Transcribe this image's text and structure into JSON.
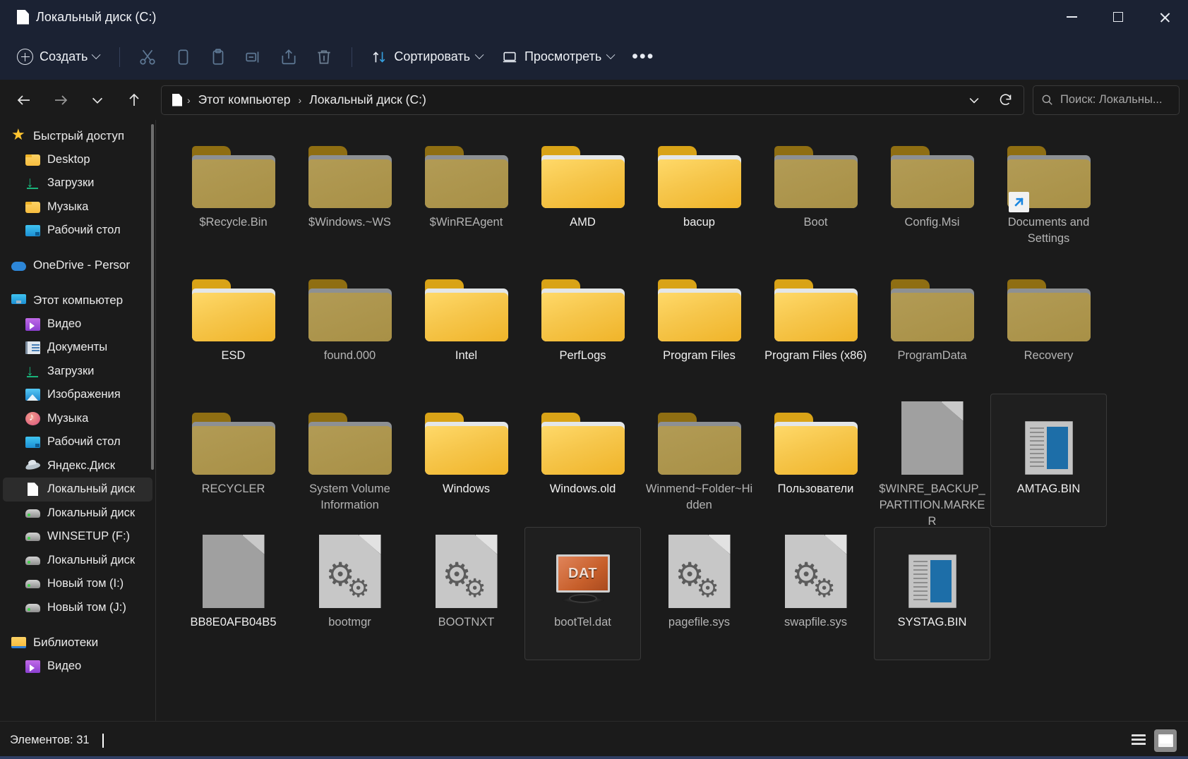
{
  "window": {
    "title": "Локальный диск (C:)",
    "title_icon": "document-icon",
    "minimize_label": "Свернуть",
    "maximize_label": "Развернуть",
    "close_label": "Закрыть"
  },
  "toolbar": {
    "new_label": "Создать",
    "cut_label": "Вырезать",
    "copy_label": "Копировать",
    "paste_label": "Вставить",
    "rename_label": "Переименовать",
    "share_label": "Поделиться",
    "delete_label": "Удалить",
    "sort_label": "Сортировать",
    "view_label": "Просмотреть",
    "more_label": "Подробнее"
  },
  "nav": {
    "back_label": "Назад",
    "forward_label": "Вперёд",
    "recent_label": "Последние расположения",
    "up_label": "Вверх",
    "refresh_label": "Обновить",
    "dropdown_label": "Предыдущие расположения"
  },
  "breadcrumb": {
    "icon": "document-icon",
    "items": [
      "Этот компьютер",
      "Локальный диск (C:)"
    ],
    "separator": "›"
  },
  "search": {
    "placeholder": "Поиск: Локальны...",
    "value": "",
    "icon": "search-icon"
  },
  "sidebar": {
    "groups": [
      {
        "items": [
          {
            "label": "Быстрый доступ",
            "icon": "star-icon",
            "level": 0,
            "selected": false
          },
          {
            "label": "Desktop",
            "icon": "folder-icon",
            "level": 1,
            "selected": false
          },
          {
            "label": "Загрузки",
            "icon": "download-icon",
            "level": 1,
            "selected": false
          },
          {
            "label": "Музыка",
            "icon": "folder-icon",
            "level": 1,
            "selected": false
          },
          {
            "label": "Рабочий стол",
            "icon": "desktop-icon",
            "level": 1,
            "selected": false
          }
        ]
      },
      {
        "items": [
          {
            "label": "OneDrive - Persor",
            "icon": "onedrive-icon",
            "level": 0,
            "selected": false
          }
        ]
      },
      {
        "items": [
          {
            "label": "Этот компьютер",
            "icon": "this-pc-icon",
            "level": 0,
            "selected": false
          },
          {
            "label": "Видео",
            "icon": "video-icon",
            "level": 1,
            "selected": false
          },
          {
            "label": "Документы",
            "icon": "documents-icon",
            "level": 1,
            "selected": false
          },
          {
            "label": "Загрузки",
            "icon": "download-icon",
            "level": 1,
            "selected": false
          },
          {
            "label": "Изображения",
            "icon": "pictures-icon",
            "level": 1,
            "selected": false
          },
          {
            "label": "Музыка",
            "icon": "music-icon",
            "level": 1,
            "selected": false
          },
          {
            "label": "Рабочий стол",
            "icon": "desktop-icon",
            "level": 1,
            "selected": false
          },
          {
            "label": "Яндекс.Диск",
            "icon": "yandex-disk-icon",
            "level": 1,
            "selected": false
          },
          {
            "label": "Локальный диск",
            "icon": "document-icon",
            "level": 1,
            "selected": true
          },
          {
            "label": "Локальный диск",
            "icon": "drive-icon",
            "level": 1,
            "selected": false
          },
          {
            "label": "WINSETUP (F:)",
            "icon": "drive-icon",
            "level": 1,
            "selected": false
          },
          {
            "label": "Локальный диск",
            "icon": "drive-icon",
            "level": 1,
            "selected": false
          },
          {
            "label": "Новый том (I:)",
            "icon": "drive-icon",
            "level": 1,
            "selected": false
          },
          {
            "label": "Новый том (J:)",
            "icon": "drive-icon",
            "level": 1,
            "selected": false
          }
        ]
      },
      {
        "items": [
          {
            "label": "Библиотеки",
            "icon": "libraries-icon",
            "level": 0,
            "selected": false
          },
          {
            "label": "Видео",
            "icon": "video-icon",
            "level": 1,
            "selected": false
          }
        ]
      }
    ]
  },
  "files": [
    {
      "name": "$Recycle.Bin",
      "type": "folder",
      "hidden": true,
      "selected": false
    },
    {
      "name": "$Windows.~WS",
      "type": "folder",
      "hidden": true,
      "selected": false
    },
    {
      "name": "$WinREAgent",
      "type": "folder",
      "hidden": true,
      "selected": false
    },
    {
      "name": "AMD",
      "type": "folder",
      "hidden": false,
      "selected": false
    },
    {
      "name": "bacup",
      "type": "folder",
      "hidden": false,
      "selected": false
    },
    {
      "name": "Boot",
      "type": "folder",
      "hidden": true,
      "selected": false
    },
    {
      "name": "Config.Msi",
      "type": "folder",
      "hidden": true,
      "selected": false
    },
    {
      "name": "Documents and Settings",
      "type": "folder",
      "hidden": true,
      "shortcut": true,
      "selected": false
    },
    {
      "name": "ESD",
      "type": "folder",
      "hidden": false,
      "selected": false
    },
    {
      "name": "found.000",
      "type": "folder",
      "hidden": true,
      "selected": false
    },
    {
      "name": "Intel",
      "type": "folder",
      "hidden": false,
      "selected": false
    },
    {
      "name": "PerfLogs",
      "type": "folder",
      "hidden": false,
      "selected": false
    },
    {
      "name": "Program Files",
      "type": "folder",
      "hidden": false,
      "selected": false
    },
    {
      "name": "Program Files (x86)",
      "type": "folder",
      "hidden": false,
      "selected": false
    },
    {
      "name": "ProgramData",
      "type": "folder",
      "hidden": true,
      "selected": false
    },
    {
      "name": "Recovery",
      "type": "folder",
      "hidden": true,
      "selected": false
    },
    {
      "name": "RECYCLER",
      "type": "folder",
      "hidden": true,
      "selected": false
    },
    {
      "name": "System Volume Information",
      "type": "folder",
      "hidden": true,
      "selected": false
    },
    {
      "name": "Windows",
      "type": "folder",
      "hidden": false,
      "selected": false
    },
    {
      "name": "Windows.old",
      "type": "folder",
      "hidden": false,
      "selected": false
    },
    {
      "name": "Winmend~Folder~Hidden",
      "type": "folder",
      "hidden": true,
      "selected": false
    },
    {
      "name": "Пользователи",
      "type": "folder",
      "hidden": false,
      "selected": false
    },
    {
      "name": "$WINRE_BACKUP_PARTITION.MARKER",
      "type": "file-blank",
      "hidden": true,
      "selected": false
    },
    {
      "name": "AMTAG.BIN",
      "type": "file-bin",
      "hidden": false,
      "selected": true
    },
    {
      "name": "BB8E0AFB04B5",
      "type": "file-blank",
      "hidden": false,
      "selected": false
    },
    {
      "name": "bootmgr",
      "type": "file-sys",
      "hidden": true,
      "selected": false
    },
    {
      "name": "BOOTNXT",
      "type": "file-sys",
      "hidden": true,
      "selected": false
    },
    {
      "name": "bootTel.dat",
      "type": "file-dat",
      "hidden": true,
      "selected": true,
      "badge": "DAT"
    },
    {
      "name": "pagefile.sys",
      "type": "file-sys",
      "hidden": true,
      "selected": false
    },
    {
      "name": "swapfile.sys",
      "type": "file-sys",
      "hidden": true,
      "selected": false
    },
    {
      "name": "SYSTAG.BIN",
      "type": "file-bin",
      "hidden": false,
      "selected": true
    }
  ],
  "status": {
    "item_count_text": "Элементов: 31",
    "list_view_label": "Список",
    "tile_view_label": "Крупные значки"
  },
  "colors": {
    "titlebar_bg": "#1b2233",
    "window_bg": "#1b1b1b",
    "folder_yellow": "#f0b429",
    "folder_dim": "#a89046",
    "accent_blue": "#2f7fd6",
    "selection_border": "#3a3a3a",
    "text_primary": "#f0f0f0"
  }
}
